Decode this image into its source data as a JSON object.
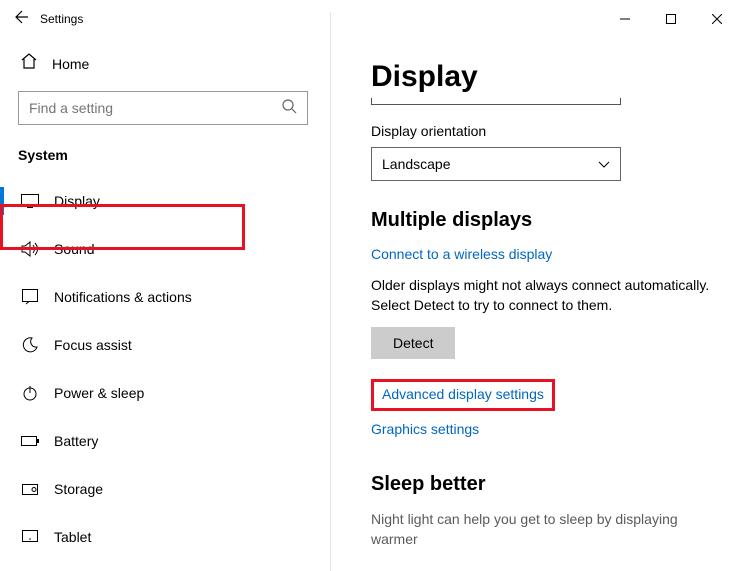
{
  "window": {
    "title": "Settings"
  },
  "sidebar": {
    "home": "Home",
    "search_placeholder": "Find a setting",
    "category": "System",
    "items": [
      {
        "label": "Display"
      },
      {
        "label": "Sound"
      },
      {
        "label": "Notifications & actions"
      },
      {
        "label": "Focus assist"
      },
      {
        "label": "Power & sleep"
      },
      {
        "label": "Battery"
      },
      {
        "label": "Storage"
      },
      {
        "label": "Tablet"
      }
    ]
  },
  "main": {
    "title": "Display",
    "orientation_label": "Display orientation",
    "orientation_value": "Landscape",
    "multi_title": "Multiple displays",
    "wireless_link": "Connect to a wireless display",
    "older_text": "Older displays might not always connect automatically. Select Detect to try to connect to them.",
    "detect_btn": "Detect",
    "advanced_link": "Advanced display settings",
    "graphics_link": "Graphics settings",
    "sleep_title": "Sleep better",
    "sleep_text": "Night light can help you get to sleep by displaying warmer"
  }
}
